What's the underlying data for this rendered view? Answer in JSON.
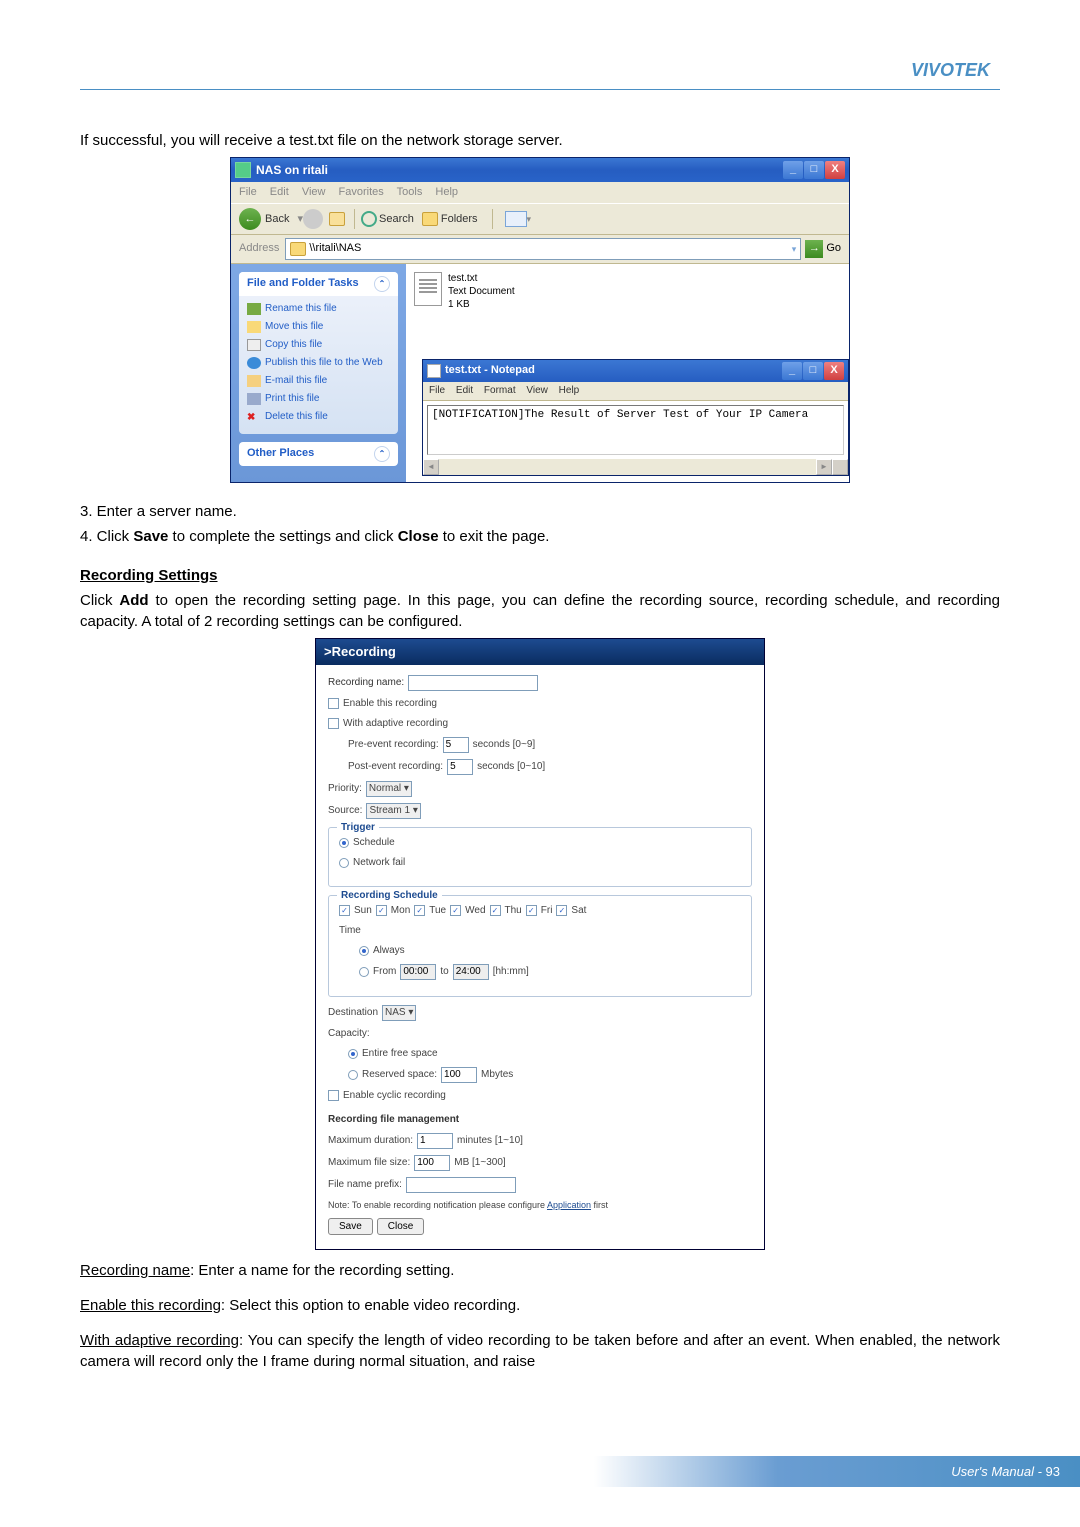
{
  "brand": "VIVOTEK",
  "intro": "If successful, you will receive a test.txt file on the network storage server.",
  "explorer": {
    "title": "NAS on ritali",
    "menu": [
      "File",
      "Edit",
      "View",
      "Favorites",
      "Tools",
      "Help"
    ],
    "back": "Back",
    "search": "Search",
    "folders": "Folders",
    "addressLabel": "Address",
    "addressValue": "\\\\ritali\\NAS",
    "go": "Go",
    "tasksTitle": "File and Folder Tasks",
    "tasks": {
      "rename": "Rename this file",
      "move": "Move this file",
      "copy": "Copy this file",
      "publish": "Publish this file to the Web",
      "email": "E-mail this file",
      "print": "Print this file",
      "delete": "Delete this file"
    },
    "otherPlaces": "Other Places",
    "file": {
      "name": "test.txt",
      "type": "Text Document",
      "size": "1 KB"
    }
  },
  "notepad": {
    "title": "test.txt - Notepad",
    "menu": [
      "File",
      "Edit",
      "Format",
      "View",
      "Help"
    ],
    "content": "[NOTIFICATION]The Result of Server Test of Your IP Camera"
  },
  "steps": {
    "s3": "3. Enter a server name.",
    "s4a": "4. Click ",
    "s4save": "Save",
    "s4b": " to complete the settings and click ",
    "s4close": "Close",
    "s4c": " to exit the page."
  },
  "recHeading": "Recording Settings",
  "recIntro": "Click Add to open the recording setting page. In this page, you can define the recording source, recording schedule, and recording capacity. A total of 2 recording settings can be configured.",
  "rec": {
    "panelTitle": ">Recording",
    "nameLabel": "Recording name:",
    "enable": "Enable this recording",
    "adaptive": "With adaptive recording",
    "preLabel": "Pre-event recording:",
    "preVal": "5",
    "preHint": "seconds [0~9]",
    "postLabel": "Post-event recording:",
    "postVal": "5",
    "postHint": "seconds [0~10]",
    "priorityLabel": "Priority:",
    "priorityVal": "Normal",
    "sourceLabel": "Source:",
    "sourceVal": "Stream 1",
    "triggerLegend": "Trigger",
    "triggerSchedule": "Schedule",
    "triggerNetfail": "Network fail",
    "schedLegend": "Recording Schedule",
    "days": [
      "Sun",
      "Mon",
      "Tue",
      "Wed",
      "Thu",
      "Fri",
      "Sat"
    ],
    "timeLabel": "Time",
    "always": "Always",
    "fromLabel": "From",
    "fromVal": "00:00",
    "toLabel": "to",
    "toVal": "24:00",
    "hhmm": "[hh:mm]",
    "destLabel": "Destination",
    "destVal": "NAS",
    "capacityLabel": "Capacity:",
    "entire": "Entire free space",
    "reservedLabel": "Reserved space:",
    "reservedVal": "100",
    "mbytes": "Mbytes",
    "cyclic": "Enable cyclic recording",
    "mgmt": "Recording file management",
    "maxDurLabel": "Maximum duration:",
    "maxDurVal": "1",
    "maxDurHint": "minutes [1~10]",
    "maxSizeLabel": "Maximum file size:",
    "maxSizeVal": "100",
    "maxSizeHint": "MB [1~300]",
    "prefixLabel": "File name prefix:",
    "note1": "Note: To enable recording notification please configure ",
    "noteLink": "Application",
    "note2": " first",
    "save": "Save",
    "close": "Close"
  },
  "tail": {
    "t1a": "Recording name",
    "t1b": ": Enter a name for the recording setting.",
    "t2a": "Enable this recording",
    "t2b": ": Select this option to enable video recording.",
    "t3a": "With adaptive recording",
    "t3b": ": You can specify the length of video recording to be taken before and after an event. When enabled, the network camera will record only the I frame during normal situation, and raise"
  },
  "footer": {
    "label": "User's Manual - ",
    "page": "93"
  }
}
